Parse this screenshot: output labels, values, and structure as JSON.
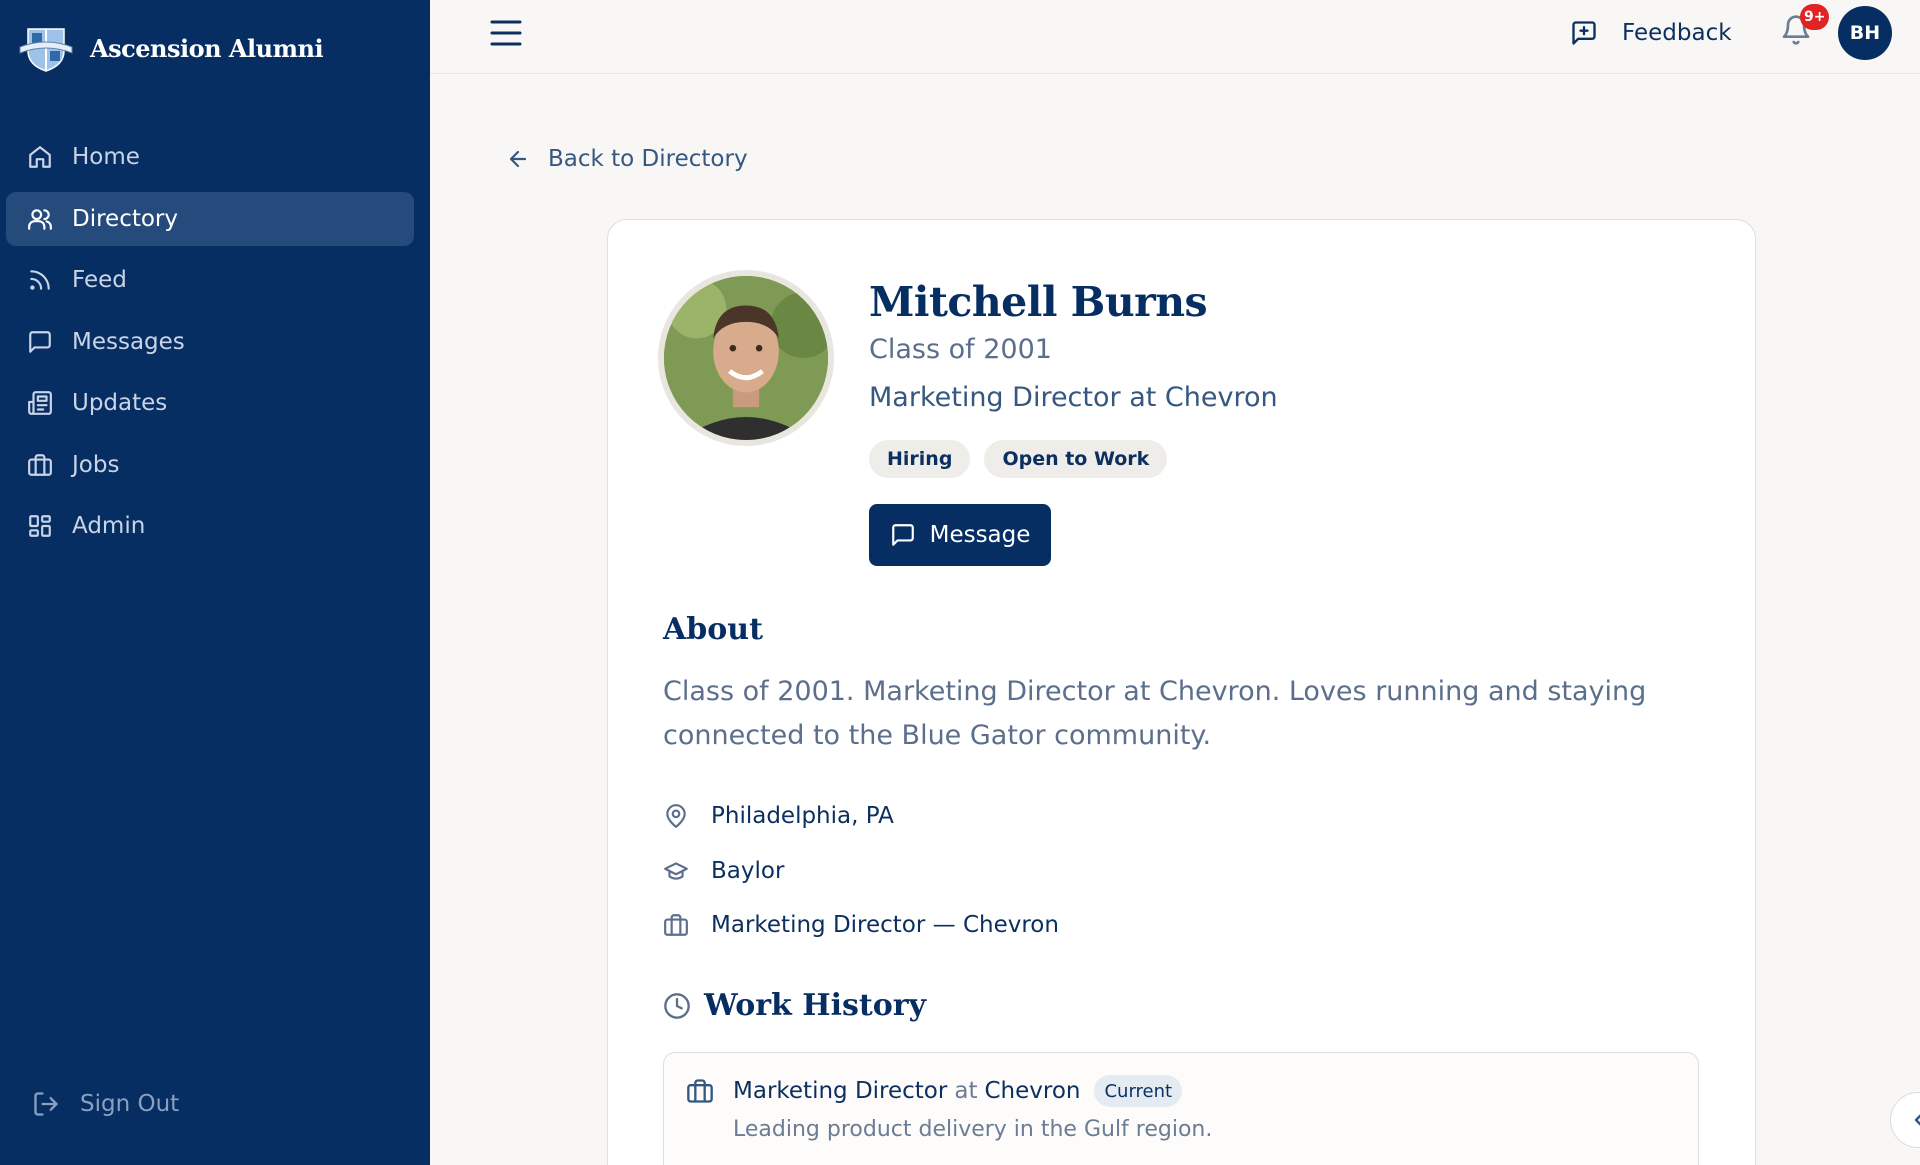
{
  "app": {
    "name": "Ascension Alumni"
  },
  "sidebar": {
    "items": [
      {
        "label": "Home",
        "icon": "home-icon"
      },
      {
        "label": "Directory",
        "icon": "users-icon",
        "active": true
      },
      {
        "label": "Feed",
        "icon": "rss-icon"
      },
      {
        "label": "Messages",
        "icon": "message-square-icon"
      },
      {
        "label": "Updates",
        "icon": "newspaper-icon"
      },
      {
        "label": "Jobs",
        "icon": "briefcase-icon"
      },
      {
        "label": "Admin",
        "icon": "grid-icon"
      }
    ],
    "sign_out": "Sign Out"
  },
  "header": {
    "feedback_label": "Feedback",
    "notification_count": "9+",
    "user_initials": "BH"
  },
  "main": {
    "back_label": "Back to Directory",
    "profile": {
      "name": "Mitchell Burns",
      "class_year": "Class of 2001",
      "position": "Marketing Director at Chevron",
      "tags": [
        "Hiring",
        "Open to Work"
      ],
      "message_label": "Message"
    },
    "about": {
      "title": "About",
      "text": "Class of 2001. Marketing Director at Chevron. Loves running and staying connected to the Blue Gator community."
    },
    "facts": {
      "location": "Philadelphia, PA",
      "education": "Baylor",
      "job": "Marketing Director — Chevron"
    },
    "work_history": {
      "title": "Work History",
      "entries": [
        {
          "role": "Marketing Director",
          "at": "at",
          "company": "Chevron",
          "badge": "Current",
          "description": "Leading product delivery in the Gulf region."
        }
      ]
    }
  },
  "colors": {
    "sidebar_bg": "#072e62",
    "accent": "#072e62",
    "badge": "#e02424"
  }
}
